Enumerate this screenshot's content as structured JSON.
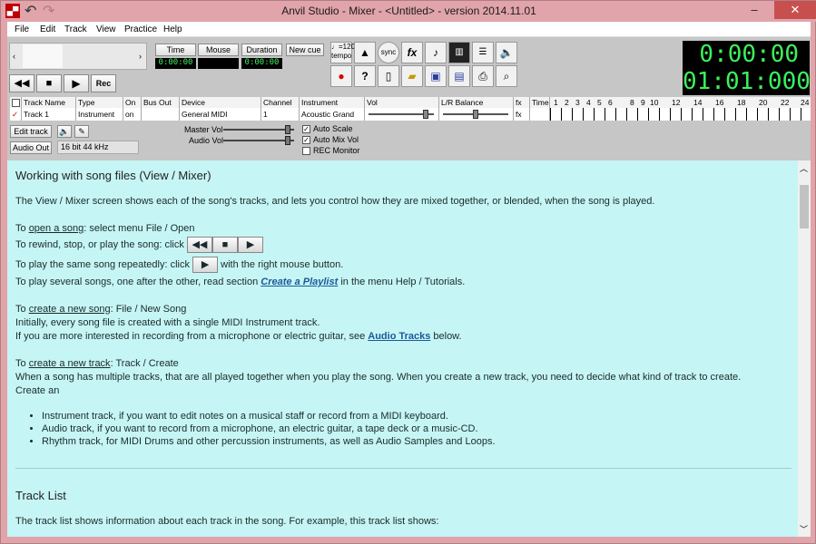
{
  "window": {
    "title": "Anvil Studio - Mixer - <Untitled> - version 2014.11.01",
    "app_icon": "anvil-icon",
    "min": "–",
    "max": "□",
    "close": "✕"
  },
  "menu": [
    "File",
    "Edit",
    "Track",
    "View",
    "Practice",
    "Help"
  ],
  "toolbar": {
    "time_label": "Time",
    "mouse_label": "Mouse",
    "duration_label": "Duration",
    "new_cue_label": "New cue",
    "time_value": "0:00:00",
    "mouse_value": "",
    "duration_value": "0:00:00",
    "rec_label": "Rec",
    "tempo_label": "♩=120",
    "tempo_sub": "tempo",
    "sync_label": "sync",
    "fx_label": "fx",
    "clock_main": "0:00:00",
    "clock_measure": "01:01:000"
  },
  "track_table": {
    "headers": [
      "",
      "Track Name",
      "Type",
      "On",
      "Bus Out",
      "Device",
      "Channel",
      "Instrument",
      "Vol",
      "L/R Balance",
      "fx",
      "Time"
    ],
    "row": {
      "check": "✓",
      "name": "Track 1",
      "type": "Instrument",
      "on": "on",
      "bus": "",
      "device": "General MIDI",
      "channel": "1",
      "instrument": "Acoustic Grand",
      "fx": "fx"
    },
    "ruler": [
      "1",
      "2",
      "3",
      "4",
      "5",
      "6",
      "8",
      "9",
      "10",
      "12",
      "14",
      "16",
      "18",
      "20",
      "22",
      "24"
    ]
  },
  "controls": {
    "edit_track": "Edit track",
    "audio_out": "Audio Out",
    "audio_format": "16 bit 44 kHz",
    "master_vol": "Master Vol",
    "audio_vol": "Audio Vol",
    "auto_scale": "Auto Scale",
    "auto_mix_vol": "Auto Mix Vol",
    "rec_monitor": "REC Monitor",
    "auto_scale_checked": true,
    "auto_mix_checked": true,
    "rec_monitor_checked": false
  },
  "content": {
    "heading1": "Working with song files (View / Mixer)",
    "intro": "The View / Mixer screen shows each of the song's tracks, and lets you control how they are mixed together, or blended, when the song is played.",
    "open_pre": "To ",
    "open_link": "open a song",
    "open_post": ": select menu File / Open",
    "rewind": "To rewind, stop, or play the song: click",
    "repeat_pre": "To play the same song repeatedly: click",
    "repeat_post": "with the right mouse button.",
    "several_pre": "To play several songs, one after the other, read section ",
    "several_link": "Create a Playlist",
    "several_post": " in the menu Help / Tutorials.",
    "create_pre": "To ",
    "create_link": "create a new song",
    "create_post": ": File / New Song",
    "initially": "Initially, every song file is created with a single MIDI Instrument track.",
    "audio_pre": "If you are more interested in recording from a microphone or electric guitar, see ",
    "audio_link": "Audio Tracks",
    "audio_post": " below.",
    "newtrack_pre": "To ",
    "newtrack_link": "create a new track",
    "newtrack_post": ": Track / Create",
    "multi1": "When a song has multiple tracks, that are all played together when you play the song. When you create a new track, you need to decide what kind of track to create.",
    "multi2": "Create an",
    "bullets": [
      "Instrument track, if you want to edit notes on a musical staff or record from a MIDI keyboard.",
      "Audio track, if you want to record from a microphone, an electric guitar, a tape deck or a music-CD.",
      "Rhythm track, for MIDI Drums and other percussion instruments, as well as Audio Samples and Loops."
    ],
    "heading2": "Track List",
    "tracklist": "The track list shows information about each track in the song. For example, this track list shows:"
  }
}
